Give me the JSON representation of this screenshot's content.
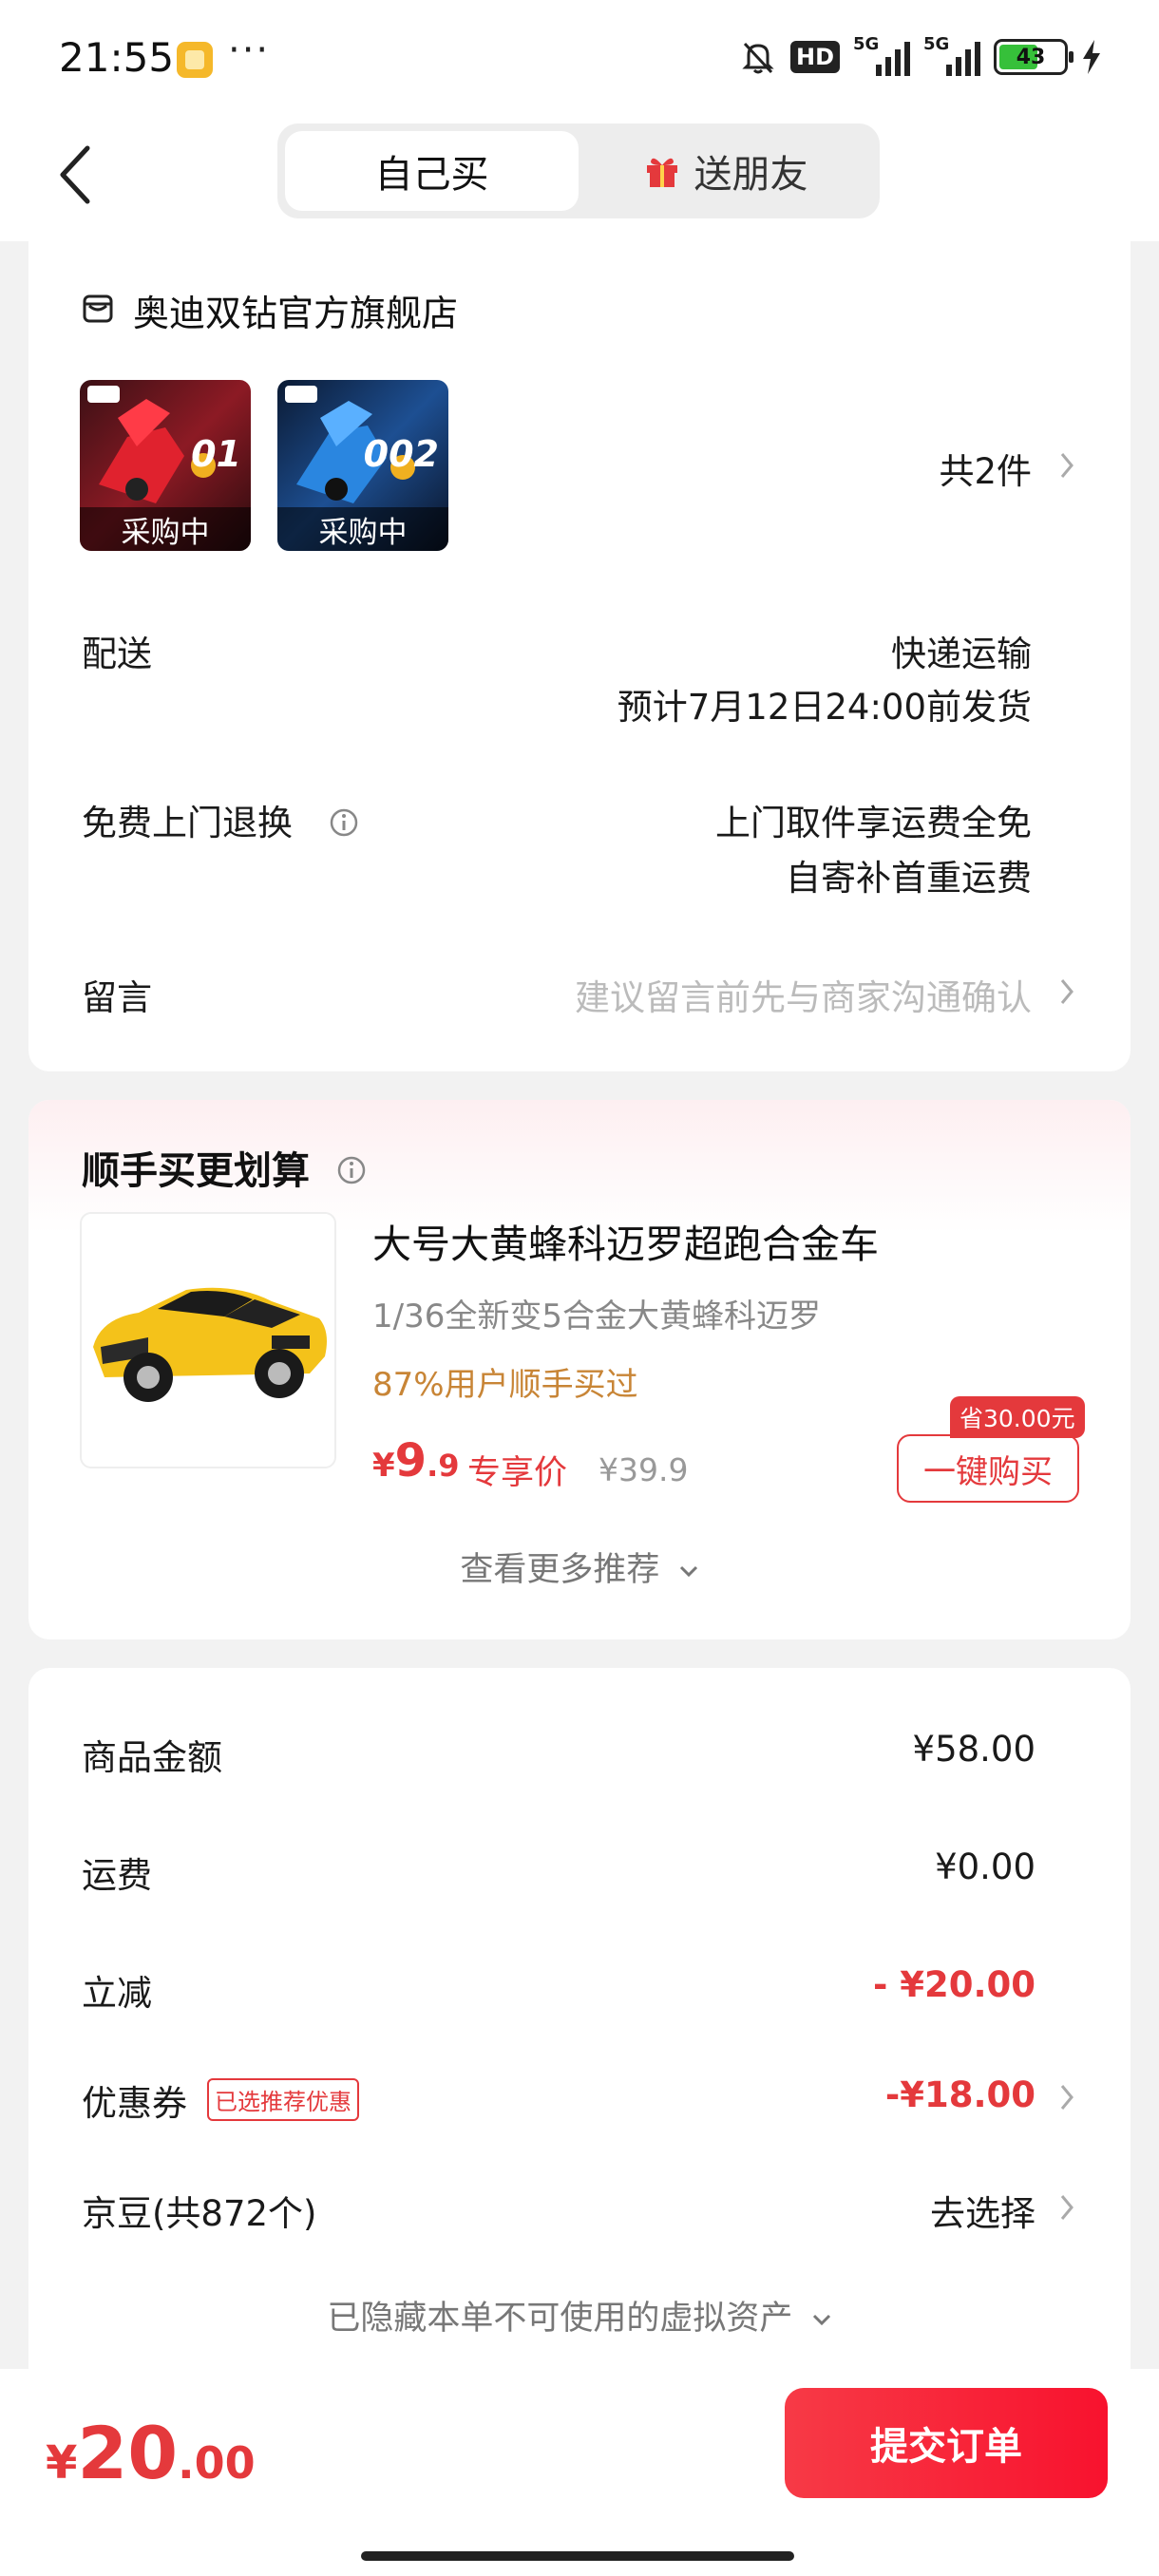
{
  "status_bar": {
    "time": "21:55",
    "dots": "···",
    "hd": "HD",
    "network_1": "5G",
    "network_2": "5G",
    "battery": "43"
  },
  "header": {
    "tab_self": "自己买",
    "tab_gift": "送朋友"
  },
  "store": {
    "name": "奥迪双钻官方旗舰店",
    "items": [
      {
        "status": "采购中",
        "number": "01",
        "color": "#c5202a"
      },
      {
        "status": "采购中",
        "number": "002",
        "color": "#1b6fc4"
      }
    ],
    "count": "共2件"
  },
  "delivery": {
    "label": "配送",
    "method": "快递运输",
    "eta": "预计7月12日24:00前发货"
  },
  "returns": {
    "label": "免费上门退换",
    "line1": "上门取件享运费全免",
    "line2": "自寄补首重运费"
  },
  "message": {
    "label": "留言",
    "placeholder": "建议留言前先与商家沟通确认"
  },
  "addon": {
    "title": "顺手买更划算",
    "product_name": "大号大黄蜂科迈罗超跑合金车",
    "product_sub": "1/36全新变5合金大黄蜂科迈罗",
    "stat": "87%用户顺手买过",
    "price_currency": "¥",
    "price_int": "9",
    "price_dec": ".9",
    "price_tag": "专享价",
    "orig_price": "¥39.9",
    "save_tag": "省30.00元",
    "buy_label": "一键购买",
    "more_label": "查看更多推荐"
  },
  "summary": {
    "goods_label": "商品金额",
    "goods_value": "¥58.00",
    "shipping_label": "运费",
    "shipping_value": "¥0.00",
    "discount_label": "立减",
    "discount_value": "- ¥20.00",
    "coupon_label": "优惠券",
    "coupon_tag": "已选推荐优惠",
    "coupon_value": "-¥18.00",
    "beans_label": "京豆(共872个)",
    "beans_value": "去选择",
    "hidden_label": "已隐藏本单不可使用的虚拟资产"
  },
  "bottom": {
    "currency": "¥",
    "total_int": "20",
    "total_dec": ".00",
    "submit_label": "提交订单"
  },
  "colors": {
    "accent": "#e4393c",
    "stat": "#c88536"
  }
}
